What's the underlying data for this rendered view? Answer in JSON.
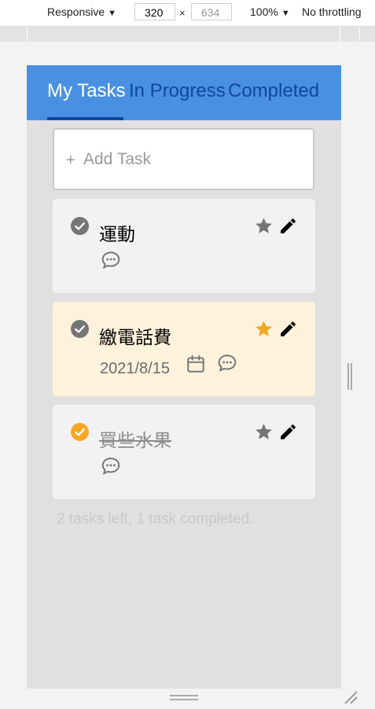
{
  "devtools": {
    "device_mode": "Responsive",
    "width": "320",
    "height": "634",
    "zoom": "100%",
    "throttling": "No throttling"
  },
  "tabs": [
    {
      "label": "My Tasks",
      "active": true
    },
    {
      "label": "In Progress",
      "active": false
    },
    {
      "label": "Completed",
      "active": false
    }
  ],
  "add_task": {
    "plus": "+",
    "label": "Add Task"
  },
  "tasks": [
    {
      "title": "運動",
      "completed": false,
      "starred": false,
      "date": "",
      "icons": [
        "check-circle-icon",
        "star-icon",
        "pencil-icon",
        "comment-icon"
      ]
    },
    {
      "title": "繳電話費",
      "completed": false,
      "starred": true,
      "date": "2021/8/15",
      "icons": [
        "check-circle-icon",
        "star-icon",
        "pencil-icon",
        "calendar-icon",
        "comment-icon"
      ]
    },
    {
      "title": "買些水果",
      "completed": true,
      "starred": false,
      "date": "",
      "icons": [
        "check-circle-icon",
        "star-icon",
        "pencil-icon",
        "comment-icon"
      ]
    }
  ],
  "status": "2 tasks left, 1 task completed.",
  "colors": {
    "header_bg": "#4a90e2",
    "tab_text": "#0d47a1",
    "tab_active_text": "#ffffff",
    "starred_card_bg": "#fff2dc",
    "star_active": "#f5a623",
    "check_completed": "#f5a623",
    "check_default": "#757575"
  }
}
